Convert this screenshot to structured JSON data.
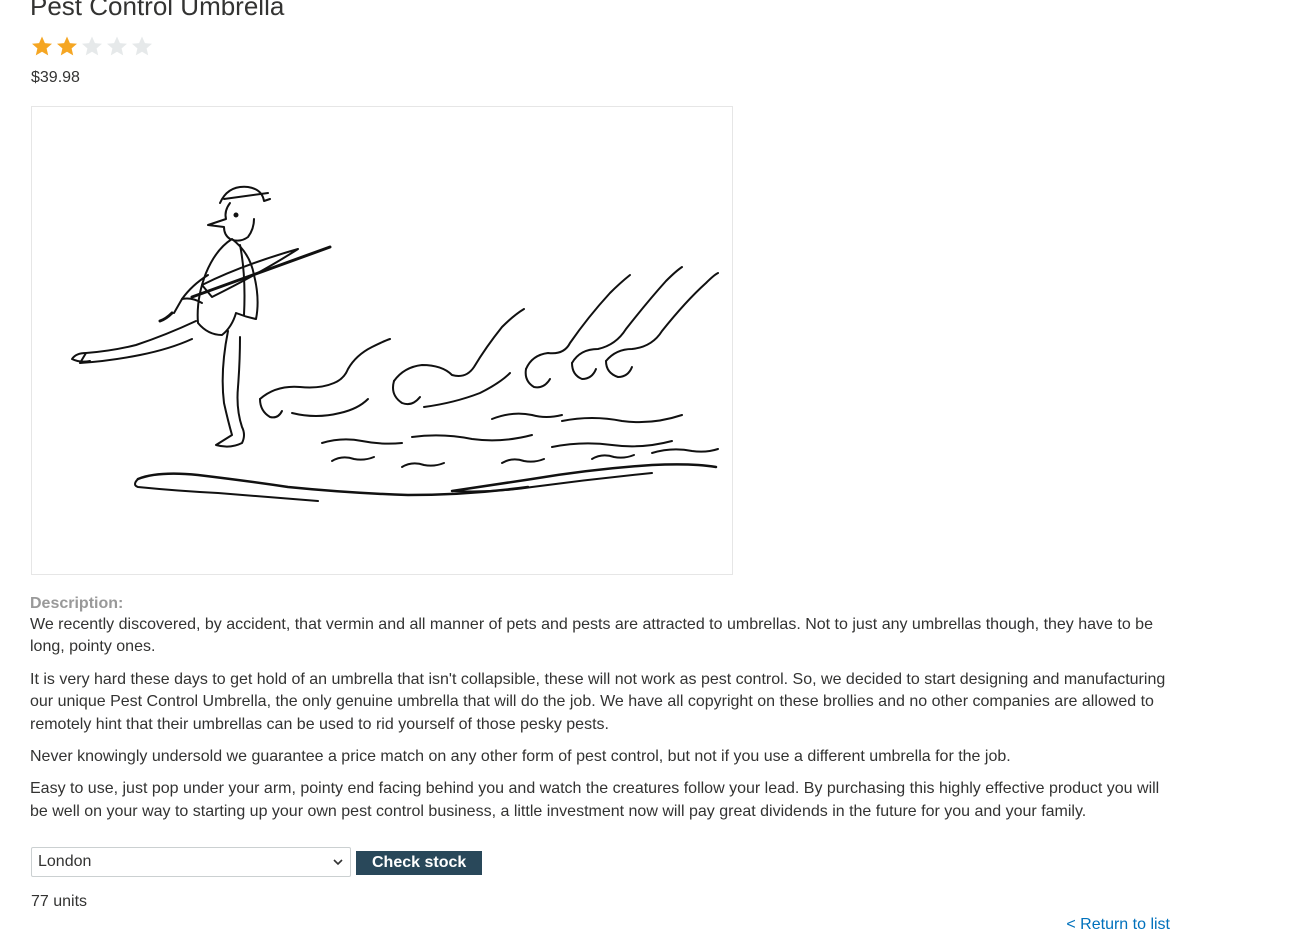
{
  "product": {
    "title": "Pest Control Umbrella",
    "rating": {
      "value": 2,
      "max": 5,
      "filled_color": "#f5a623",
      "empty_color": "#e6e9ea"
    },
    "price": "$39.98",
    "image": {
      "icon": "man-with-umbrella-followed-by-pests-illustration"
    }
  },
  "description": {
    "label": "Description:",
    "paragraphs": [
      "We recently discovered, by accident, that vermin and all manner of pets and pests are attracted to umbrellas. Not to just any umbrellas though, they have to be long, pointy ones.",
      "It is very hard these days to get hold of an umbrella that isn't collapsible, these will not work as pest control. So, we decided to start designing and manufacturing our unique Pest Control Umbrella, the only genuine umbrella that will do the job. We have all copyright on these brollies and no other companies are allowed to remotely hint that their umbrellas can be used to rid yourself of those pesky pests.",
      "Never knowingly undersold we guarantee a price match on any other form of pest control, but not if you use a different umbrella for the job.",
      "Easy to use, just pop under your arm, pointy end facing behind you and watch the creatures follow your lead. By purchasing this highly effective product you will be well on your way to starting up your own pest control business, a little investment now will pay great dividends in the future for you and your family."
    ]
  },
  "stock_check": {
    "store_selected": "London",
    "button_label": "Check stock",
    "button_color": "#29485a",
    "result": "77 units"
  },
  "navigation": {
    "return_label": "< Return to list",
    "link_color": "#0071bc"
  }
}
